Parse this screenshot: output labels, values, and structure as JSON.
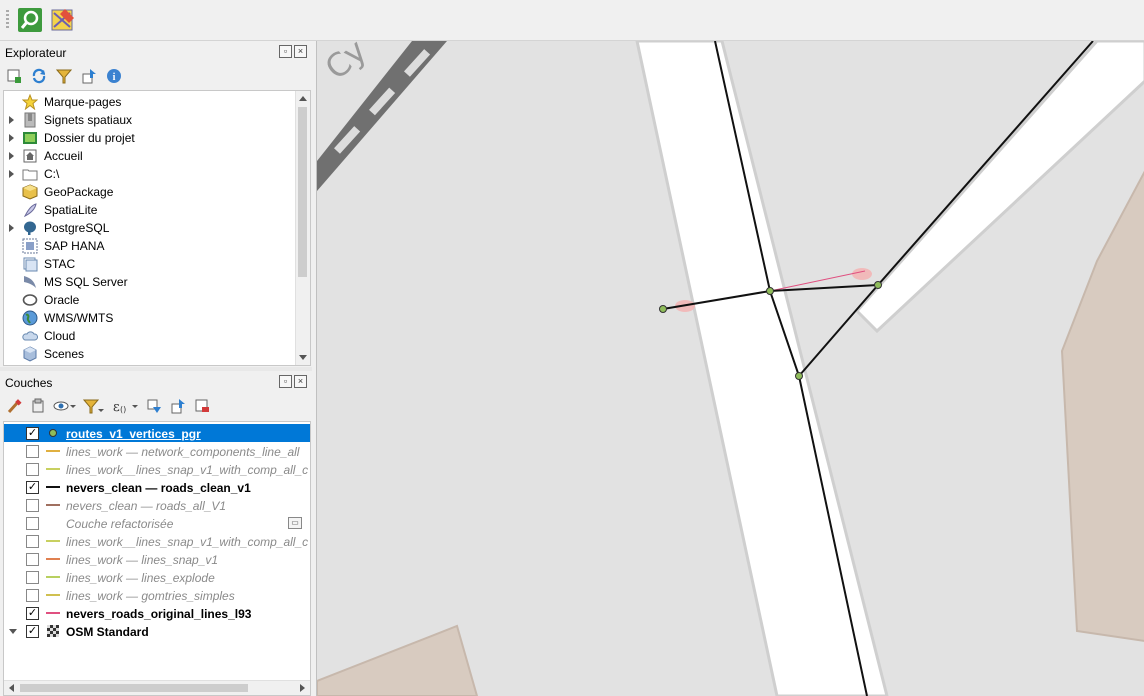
{
  "toolbar": {
    "buttons": [
      {
        "icon": "zoom-to-search-icon"
      },
      {
        "icon": "digitize-edit-icon"
      }
    ]
  },
  "explorer": {
    "title": "Explorateur",
    "tools": [
      "add-selected-layers-icon",
      "refresh-icon",
      "filter-icon",
      "collapse-all-icon",
      "properties-info-icon"
    ],
    "items": [
      {
        "label": "Marque-pages",
        "icon": "star-icon",
        "expandable": false
      },
      {
        "label": "Signets spatiaux",
        "icon": "spatial-bookmarks-icon",
        "expandable": true
      },
      {
        "label": "Dossier du projet",
        "icon": "project-folder-icon",
        "expandable": true
      },
      {
        "label": "Accueil",
        "icon": "home-icon",
        "expandable": true
      },
      {
        "label": "C:\\",
        "icon": "drive-folder-icon",
        "expandable": true
      },
      {
        "label": "GeoPackage",
        "icon": "geopackage-icon",
        "expandable": false
      },
      {
        "label": "SpatiaLite",
        "icon": "spatialite-feather-icon",
        "expandable": false
      },
      {
        "label": "PostgreSQL",
        "icon": "postgresql-elephant-icon",
        "expandable": true
      },
      {
        "label": "SAP HANA",
        "icon": "sap-hana-icon",
        "expandable": false
      },
      {
        "label": "STAC",
        "icon": "stac-icon",
        "expandable": false
      },
      {
        "label": "MS SQL Server",
        "icon": "mssql-icon",
        "expandable": false
      },
      {
        "label": "Oracle",
        "icon": "oracle-icon",
        "expandable": false
      },
      {
        "label": "WMS/WMTS",
        "icon": "wms-globe-icon",
        "expandable": false
      },
      {
        "label": "Cloud",
        "icon": "cloud-icon",
        "expandable": false
      },
      {
        "label": "Scenes",
        "icon": "scenes-cube-icon",
        "expandable": false
      }
    ]
  },
  "layers": {
    "title": "Couches",
    "tools": [
      "style-brush-icon",
      "add-group-icon",
      "visibility-eye-icon",
      "filter-legend-icon",
      "filter-expression-icon",
      "expand-all-icon",
      "collapse-all-icon",
      "remove-layer-icon"
    ],
    "items": [
      {
        "label": "routes_v1_vertices_pgr",
        "checked": true,
        "state": "selected",
        "symbol": "point",
        "symbol_color": "#8fbc5a"
      },
      {
        "label": "lines_work — network_components_line_all",
        "checked": false,
        "state": "off",
        "symbol": "line",
        "symbol_color": "#e0b040"
      },
      {
        "label": "lines_work__lines_snap_v1_with_comp_all_c",
        "checked": false,
        "state": "off",
        "symbol": "line",
        "symbol_color": "#c8d060"
      },
      {
        "label": "nevers_clean — roads_clean_v1",
        "checked": true,
        "state": "on",
        "symbol": "line",
        "symbol_color": "#111111"
      },
      {
        "label": "nevers_clean — roads_all_V1",
        "checked": false,
        "state": "off",
        "symbol": "line",
        "symbol_color": "#a07060"
      },
      {
        "label": "Couche refactorisée",
        "checked": false,
        "state": "off",
        "symbol": "none",
        "symbol_color": "",
        "has_indicator": true
      },
      {
        "label": "lines_work__lines_snap_v1_with_comp_all_c",
        "checked": false,
        "state": "off",
        "symbol": "line",
        "symbol_color": "#c8d060"
      },
      {
        "label": "lines_work — lines_snap_v1",
        "checked": false,
        "state": "off",
        "symbol": "line",
        "symbol_color": "#e08050"
      },
      {
        "label": "lines_work — lines_explode",
        "checked": false,
        "state": "off",
        "symbol": "line",
        "symbol_color": "#b8d060"
      },
      {
        "label": "lines_work — gomtries_simples",
        "checked": false,
        "state": "off",
        "symbol": "line",
        "symbol_color": "#d0c050"
      },
      {
        "label": "nevers_roads_original_lines_l93",
        "checked": true,
        "state": "on",
        "symbol": "line",
        "symbol_color": "#e05080"
      },
      {
        "label": "OSM Standard",
        "checked": true,
        "state": "on",
        "symbol": "raster",
        "symbol_color": "#333333",
        "expanded": true
      }
    ]
  },
  "colors": {
    "selection": "#0078d7",
    "vertex_fill": "#8fbc5a",
    "road_line": "#111111",
    "original_line": "#e05080",
    "map_bg": "#e2e2e2",
    "building": "#d8cbc0"
  }
}
